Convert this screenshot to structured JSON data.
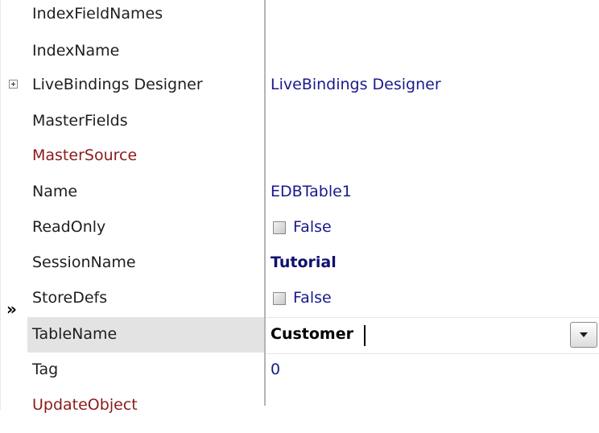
{
  "inspector": {
    "rows": [
      {
        "name": "IndexFieldNames",
        "value": ""
      },
      {
        "name": "IndexName",
        "value": ""
      },
      {
        "name": "LiveBindings Designer",
        "value": "LiveBindings Designer"
      },
      {
        "name": "MasterFields",
        "value": ""
      },
      {
        "name": "MasterSource",
        "value": ""
      },
      {
        "name": "Name",
        "value": "EDBTable1"
      },
      {
        "name": "ReadOnly",
        "value": "False"
      },
      {
        "name": "SessionName",
        "value": "Tutorial"
      },
      {
        "name": "StoreDefs",
        "value": "False"
      },
      {
        "name": "TableName",
        "value": "Customer"
      },
      {
        "name": "Tag",
        "value": "0"
      },
      {
        "name": "UpdateObject",
        "value": ""
      }
    ],
    "selected_marker": "»",
    "colors": {
      "link_property": "#8b1a1a",
      "value_text": "#1a1a8c",
      "selected_row": "#e3e3e3"
    },
    "icons": [
      "expand-plus-icon",
      "checkbox-icon",
      "dropdown-arrow-icon"
    ]
  }
}
